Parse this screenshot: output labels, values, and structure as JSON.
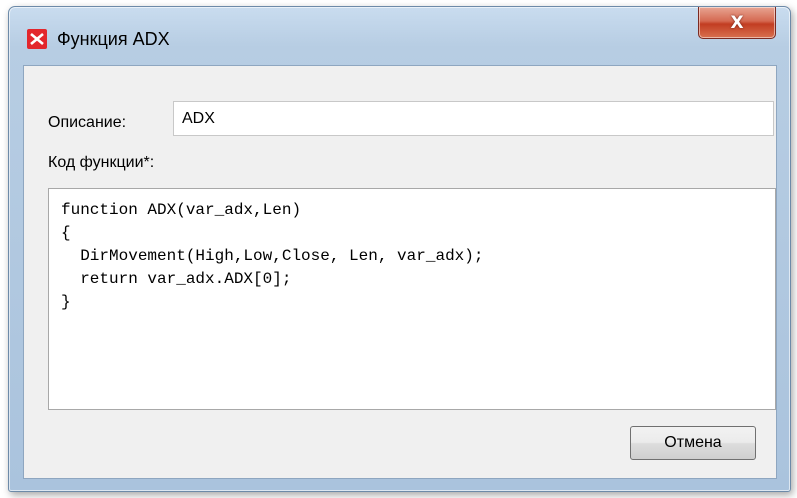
{
  "window": {
    "title": "Функция ADX",
    "close_label": "X"
  },
  "icons": {
    "app": "app-logo-icon",
    "close": "close-icon"
  },
  "form": {
    "description_label": "Описание:",
    "description_value": "ADX",
    "code_label": "Код функции*:",
    "code_value": "function ADX(var_adx,Len)\n{\n  DirMovement(High,Low,Close, Len, var_adx);\n  return var_adx.ADX[0];\n}"
  },
  "buttons": {
    "cancel_label": "Отмена"
  },
  "colors": {
    "app_icon": "#e3262c",
    "close_button": "#c23d22",
    "client_background": "#f0f0f0"
  }
}
